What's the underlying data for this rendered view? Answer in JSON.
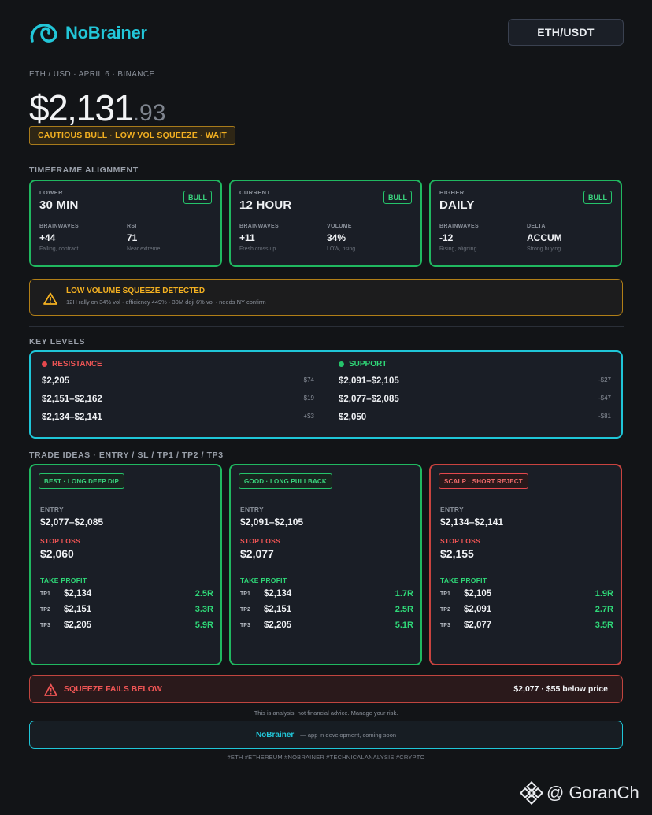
{
  "brand": {
    "name": "NoBrainer"
  },
  "header": {
    "pair_button": "ETH/USDT"
  },
  "meta": "ETH / USD  ·  APRIL 6  ·  BINANCE",
  "price": {
    "main": "$2,131",
    "cents": ".93"
  },
  "signal": "CAUTIOUS BULL  ·  LOW VOL SQUEEZE  ·  WAIT",
  "timeframe": {
    "section_label": "TIMEFRAME ALIGNMENT",
    "cards": [
      {
        "kind": "LOWER",
        "name": "30 MIN",
        "badge": "BULL",
        "stat1": {
          "label": "BRAINWAVES",
          "value": "+44",
          "sub": "Falling, contract"
        },
        "stat2": {
          "label": "RSI",
          "value": "71",
          "sub": "Near extreme"
        }
      },
      {
        "kind": "CURRENT",
        "name": "12 HOUR",
        "badge": "BULL",
        "stat1": {
          "label": "BRAINWAVES",
          "value": "+11",
          "sub": "Fresh cross up"
        },
        "stat2": {
          "label": "VOLUME",
          "value": "34%",
          "sub": "LOW, rising"
        }
      },
      {
        "kind": "HIGHER",
        "name": "DAILY",
        "badge": "BULL",
        "stat1": {
          "label": "BRAINWAVES",
          "value": "-12",
          "sub": "Rising, aligning"
        },
        "stat2": {
          "label": "DELTA",
          "value": "ACCUM",
          "sub": "Strong buying"
        }
      }
    ]
  },
  "alert": {
    "title": "LOW VOLUME SQUEEZE DETECTED",
    "text": "12H rally on 34% vol  ·  efficiency 449%  ·  30M doji 6% vol  ·  needs NY confirm"
  },
  "key_levels": {
    "section_label": "KEY LEVELS",
    "resistance": {
      "label": "RESISTANCE",
      "rows": [
        {
          "range": "$2,205",
          "delta": "+$74"
        },
        {
          "range": "$2,151–$2,162",
          "delta": "+$19"
        },
        {
          "range": "$2,134–$2,141",
          "delta": "+$3"
        }
      ]
    },
    "support": {
      "label": "SUPPORT",
      "rows": [
        {
          "range": "$2,091–$2,105",
          "delta": "-$27"
        },
        {
          "range": "$2,077–$2,085",
          "delta": "-$47"
        },
        {
          "range": "$2,050",
          "delta": "-$81"
        }
      ]
    }
  },
  "trades": {
    "section_label": "TRADE IDEAS  ·  ENTRY / SL / TP1 / TP2 / TP3",
    "entry_label": "ENTRY",
    "stop_label": "STOP LOSS",
    "tp_label": "TAKE PROFIT",
    "cards": [
      {
        "tag": "BEST  ·  LONG DEEP DIP",
        "entry": "$2,077–$2,085",
        "stop": "$2,060",
        "tps": [
          {
            "k": "TP1",
            "p": "$2,134",
            "r": "2.5R"
          },
          {
            "k": "TP2",
            "p": "$2,151",
            "r": "3.3R"
          },
          {
            "k": "TP3",
            "p": "$2,205",
            "r": "5.9R"
          }
        ]
      },
      {
        "tag": "GOOD  ·  LONG PULLBACK",
        "entry": "$2,091–$2,105",
        "stop": "$2,077",
        "tps": [
          {
            "k": "TP1",
            "p": "$2,134",
            "r": "1.7R"
          },
          {
            "k": "TP2",
            "p": "$2,151",
            "r": "2.5R"
          },
          {
            "k": "TP3",
            "p": "$2,205",
            "r": "5.1R"
          }
        ]
      },
      {
        "tag": "SCALP  ·  SHORT REJECT",
        "entry": "$2,134–$2,141",
        "stop": "$2,155",
        "tps": [
          {
            "k": "TP1",
            "p": "$2,105",
            "r": "1.9R"
          },
          {
            "k": "TP2",
            "p": "$2,091",
            "r": "2.7R"
          },
          {
            "k": "TP3",
            "p": "$2,077",
            "r": "3.5R"
          }
        ]
      }
    ]
  },
  "fail": {
    "title": "SQUEEZE FAILS BELOW",
    "detail": "$2,077  ·  $55 below price"
  },
  "disclaimer": "This is analysis, not financial advice. Manage your risk.",
  "promo": {
    "name": "NoBrainer",
    "text": "— app in development, coming soon"
  },
  "hashtags": "#ETH  #ETHEREUM  #NOBRAINER  #TECHNICALANALYSIS  #CRYPTO",
  "watermark": "@ GoranCh",
  "colors": {
    "accent": "#22c6d8",
    "bull": "#25c46b",
    "bear": "#e5484d",
    "warn": "#f3b021"
  }
}
